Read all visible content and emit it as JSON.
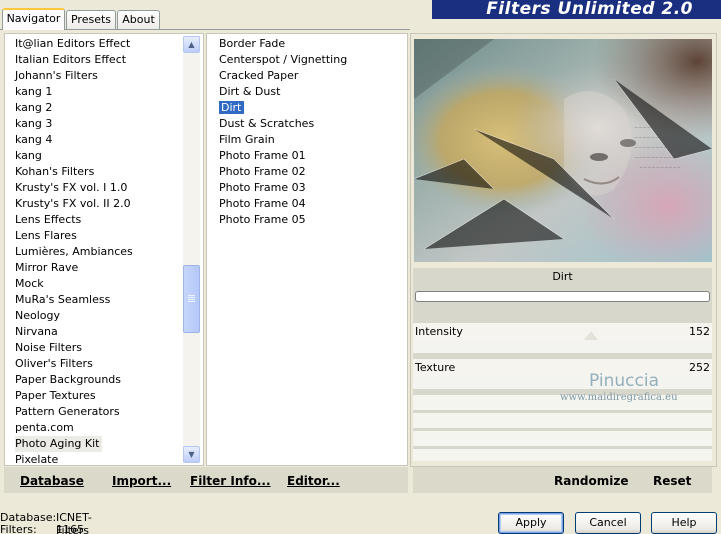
{
  "tabs": [
    {
      "label": "Navigator",
      "active": true
    },
    {
      "label": "Presets",
      "active": false
    },
    {
      "label": "About",
      "active": false
    }
  ],
  "banner_title": "Filters Unlimited 2.0",
  "categories": [
    "It@lian Editors Effect",
    "Italian Editors Effect",
    "Johann's Filters",
    "kang 1",
    "kang 2",
    "kang 3",
    "kang 4",
    "kang",
    "Kohan's Filters",
    "Krusty's FX vol. I 1.0",
    "Krusty's FX vol. II 2.0",
    "Lens Effects",
    "Lens Flares",
    "Lumières, Ambiances",
    "Mirror Rave",
    "Mock",
    "MuRa's Seamless",
    "Neology",
    "Nirvana",
    "Noise Filters",
    "Oliver's Filters",
    "Paper Backgrounds",
    "Paper Textures",
    "Pattern Generators",
    "penta.com",
    "Photo Aging Kit",
    "Pixelate"
  ],
  "selected_category": "Photo Aging Kit",
  "filters": [
    "Border Fade",
    "Centerspot / Vignetting",
    "Cracked Paper",
    "Dirt & Dust",
    "Dirt",
    "Dust & Scratches",
    "Film Grain",
    "Photo Frame 01",
    "Photo Frame 02",
    "Photo Frame 03",
    "Photo Frame 04",
    "Photo Frame 05"
  ],
  "selected_filter": "Dirt",
  "left_bar": {
    "database": "Database",
    "import": "Import...",
    "filter_info": "Filter Info...",
    "editor": "Editor..."
  },
  "right_bar": {
    "randomize": "Randomize",
    "reset": "Reset"
  },
  "filter_name": "Dirt",
  "params": [
    {
      "label": "Intensity",
      "value": "152"
    },
    {
      "label": "Texture",
      "value": "252"
    }
  ],
  "watermark": {
    "line1": "Pinuccia",
    "line2": "www.maidiregrafica.eu"
  },
  "status": {
    "database_label": "Database:",
    "database_value": "ICNET-Filters",
    "filters_label": "Filters:",
    "filters_value": "1165"
  },
  "buttons": {
    "apply": "Apply",
    "cancel": "Cancel",
    "help": "Help"
  },
  "colors": {
    "banner": "#1a2f80",
    "selection": "#316ac5",
    "window": "#ece9d8"
  }
}
